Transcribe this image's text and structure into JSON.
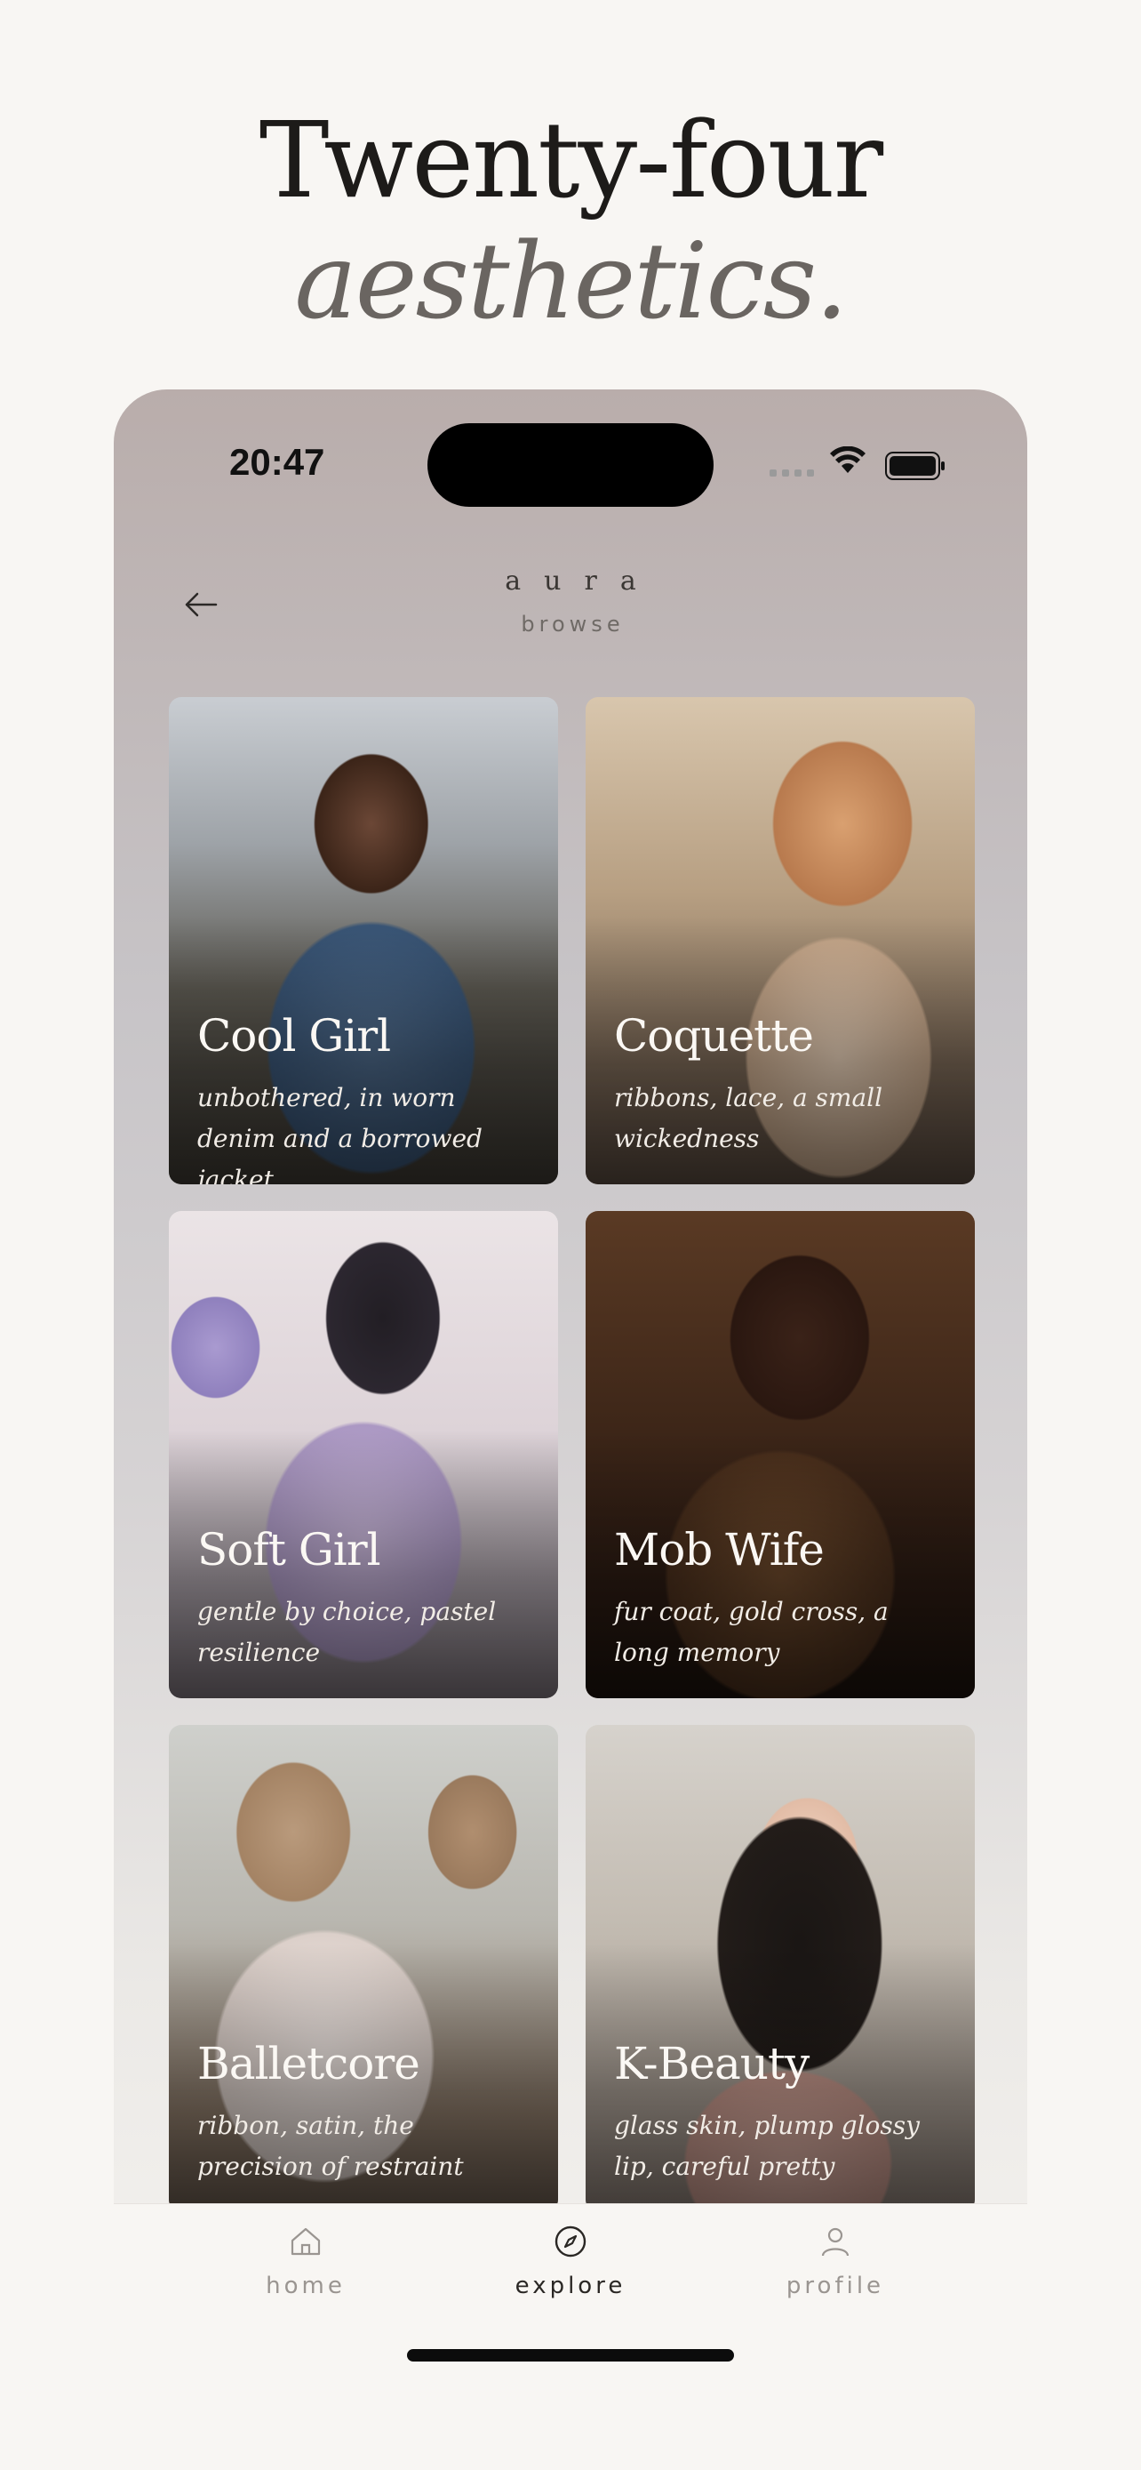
{
  "headline": {
    "line1": "Twenty-four",
    "line2": "aesthetics."
  },
  "status_bar": {
    "time": "20:47"
  },
  "header": {
    "brand": "aura",
    "subtitle": "browse"
  },
  "cards": [
    {
      "title": "Cool Girl",
      "description": "unbothered, in worn denim and a borrowed jacket"
    },
    {
      "title": "Coquette",
      "description": "ribbons, lace, a small wickedness"
    },
    {
      "title": "Soft Girl",
      "description": "gentle by choice, pastel resilience"
    },
    {
      "title": "Mob Wife",
      "description": "fur coat, gold cross, a long memory"
    },
    {
      "title": "Balletcore",
      "description": "ribbon, satin, the precision of restraint"
    },
    {
      "title": "K-Beauty",
      "description": "glass skin, plump glossy lip, careful pretty"
    }
  ],
  "tabs": [
    {
      "label": "home",
      "icon": "home-icon",
      "active": false
    },
    {
      "label": "explore",
      "icon": "compass-icon",
      "active": true
    },
    {
      "label": "profile",
      "icon": "person-icon",
      "active": false
    }
  ],
  "colors": {
    "background": "#f8f6f3",
    "text_dark": "#1d1b19",
    "text_muted": "#6a6561",
    "tab_inactive": "#9a9591",
    "tab_active": "#2a2724"
  }
}
